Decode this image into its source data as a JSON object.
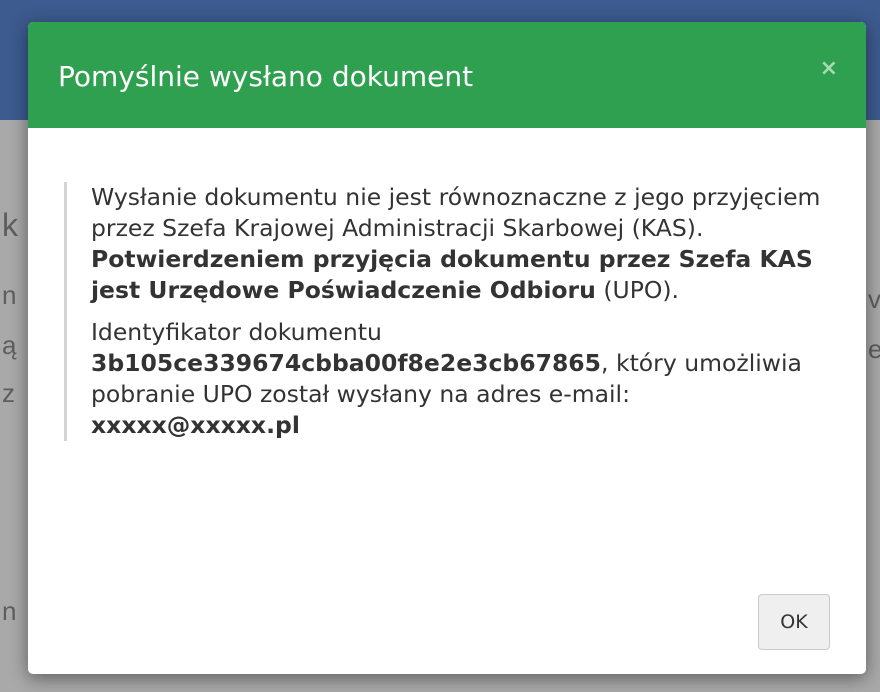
{
  "background": {
    "fragments": [
      "k",
      "n",
      "ą",
      "z",
      "n",
      "v",
      "e"
    ]
  },
  "dialog": {
    "title": "Pomyślnie wysłano dokument",
    "close_symbol": "×",
    "paragraph1": {
      "text": "Wysłanie dokumentu nie jest równoznaczne z jego przyjęciem przez Szefa Krajowej Administracji Skarbowej (KAS). ",
      "bold": "Potwierdzeniem przyjęcia dokumentu przez Szefa KAS jest Urzędowe Poświadczenie Odbioru",
      "tail": " (UPO)."
    },
    "paragraph2": {
      "label": "Identyfikator dokumentu ",
      "doc_id": "3b105ce339674cbba00f8e2e3cb67865",
      "middle": ", który umożliwia pobranie UPO został wysłany na adres e-mail: ",
      "email": "xxxxx@xxxxx.pl"
    },
    "ok_label": "OK"
  },
  "colors": {
    "header": "#2ea04f",
    "page_header": "#3d5b8f",
    "overlay": "#a9a9a9"
  }
}
